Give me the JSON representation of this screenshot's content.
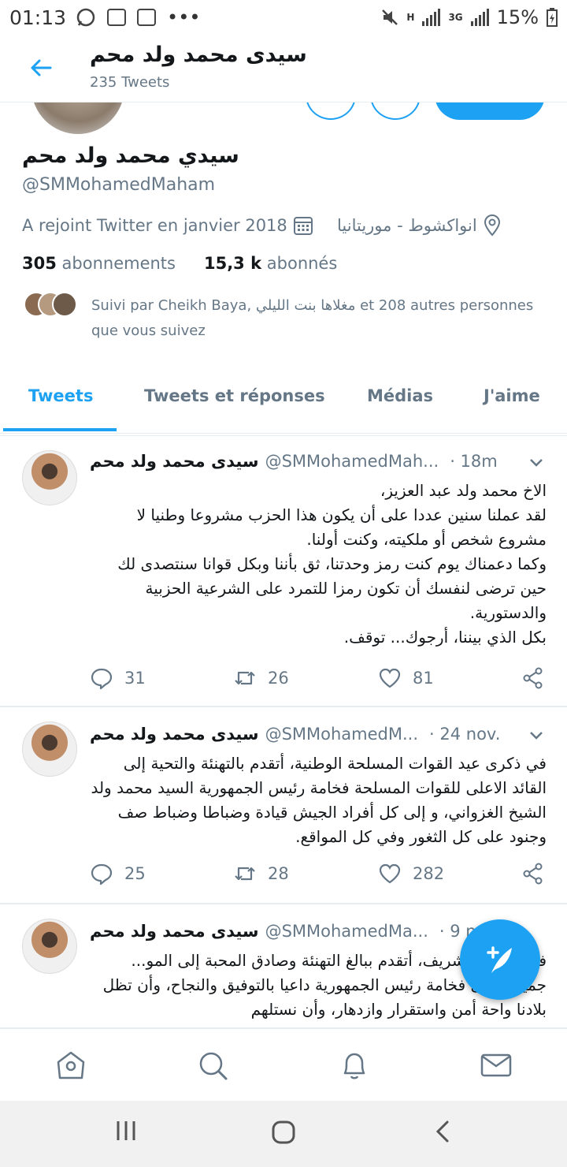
{
  "status_bar": {
    "time": "01:13",
    "battery": "15%",
    "network_h": "H",
    "network_3g": "3G",
    "more": "•••"
  },
  "header": {
    "name": "سيدى محمد ولد محم",
    "tweet_count": "235 Tweets"
  },
  "profile": {
    "display_name": "سيدي محمد ولد محم",
    "handle": "@SMMohamedMaham",
    "joined": "A rejoint Twitter en janvier 2018",
    "location": "انواكشوط - موريتانيا",
    "following_count": "305",
    "following_label": "abonnements",
    "followers_count": "15,3 k",
    "followers_label": "abonnés",
    "followed_by": "Suivi par Cheikh Baya, مغلاها بنت الليلي et 208 autres personnes que vous suivez"
  },
  "tabs": [
    {
      "label": "Tweets",
      "active": true
    },
    {
      "label": "Tweets et réponses",
      "active": false
    },
    {
      "label": "Médias",
      "active": false
    },
    {
      "label": "J'aime",
      "active": false
    }
  ],
  "tweets": [
    {
      "name": "سيدى محمد ولد محم",
      "handle": "@SMMohamedMah...",
      "time": "· 18m",
      "text": "الاخ محمد  ولد عبد العزيز،\nلقد عملنا سنين عددا على أن يكون هذا الحزب مشروعا وطنيا لا مشروع شخص أو ملكيته، وكنت أولنا.\nوكما دعمناك يوم كنت رمز وحدتنا، ثق بأننا وبكل قوانا سنتصدى لك حين ترضى لنفسك أن تكون رمزا للتمرد على الشرعية الحزبية والدستورية.\nبكل الذي بيننا، أرجوك... توقف.",
      "replies": "31",
      "retweets": "26",
      "likes": "81"
    },
    {
      "name": "سيدى محمد ولد محم",
      "handle": "@SMMohamedM...",
      "time": "· 24 nov.",
      "text": "في ذكرى عيد القوات المسلحة الوطنية، أتقدم بالتهنئة والتحية إلى القائد الاعلى للقوات المسلحة فخامة رئيس الجمهورية السيد محمد ولد الشيخ الغزواني، و إلى كل أفراد الجيش قيادة وضباطا وضباط صف وجنود على كل الثغور وفي كل المواقع.",
      "replies": "25",
      "retweets": "28",
      "likes": "282"
    },
    {
      "name": "سيدى محمد ولد محم",
      "handle": "@SMMohamedMa...",
      "time": "· 9 n",
      "text": "في ... ولد الشريف، أتقدم ببالغ التهنئة وصادق المحبة إلى المو... جميعا، وإلى فخامة رئيس الجمهورية داعيا بالتوفيق والنجاح، وأن تظل بلادنا واحة أمن واستقرار وازدهار، وأن نستلهم"
    }
  ],
  "colors": {
    "accent": "#1da1f2",
    "text": "#14171a",
    "muted": "#657786"
  },
  "icons": [
    "back-arrow-icon",
    "calendar-icon",
    "location-pin-icon",
    "reply-icon",
    "retweet-icon",
    "like-icon",
    "share-icon",
    "compose-tweet-icon",
    "home-icon",
    "search-icon",
    "notifications-icon",
    "messages-icon"
  ]
}
